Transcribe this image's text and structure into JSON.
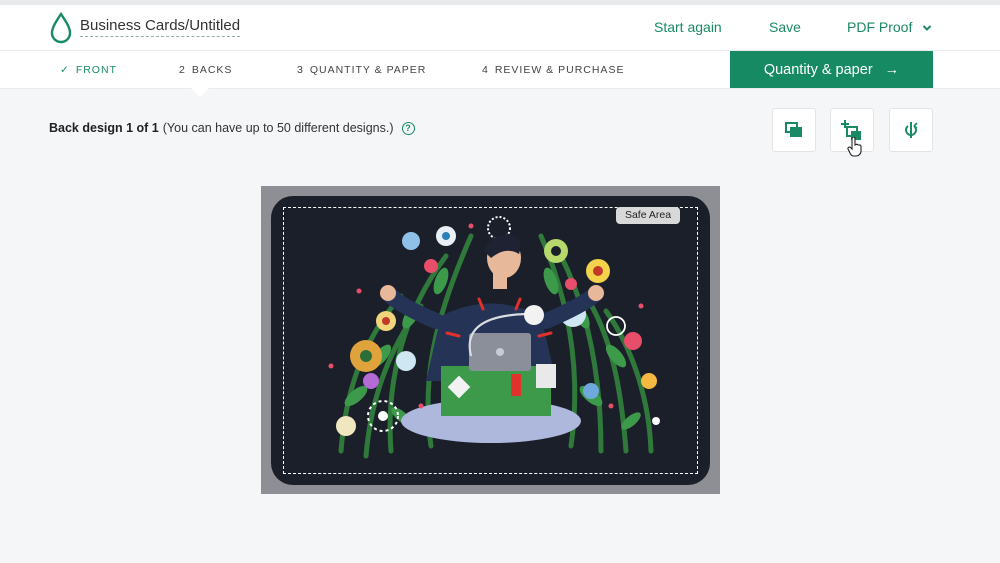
{
  "header": {
    "doc_title": "Business Cards/Untitled",
    "start_again": "Start again",
    "save": "Save",
    "pdf_proof": "PDF Proof"
  },
  "steps": [
    {
      "num": "✓",
      "label": "FRONT",
      "state": "done"
    },
    {
      "num": "2",
      "label": "BACKS",
      "state": "active"
    },
    {
      "num": "3",
      "label": "QUANTITY & PAPER",
      "state": "todo"
    },
    {
      "num": "4",
      "label": "REVIEW & PURCHASE",
      "state": "todo"
    }
  ],
  "cta": {
    "label": "Quantity & paper",
    "arrow": "→"
  },
  "design_info": {
    "bold": "Back design 1 of 1",
    "note": "(You can have up to 50 different designs.)",
    "help": "?"
  },
  "canvas": {
    "safe_area_label": "Safe Area"
  },
  "colors": {
    "accent": "#168a63",
    "card_bg": "#1b1f2a",
    "canvas_bg": "#8d8f94"
  },
  "icons": [
    "drop-logo-icon",
    "chevron-down-icon",
    "arrow-right-icon",
    "help-icon",
    "duplicate-design-icon",
    "add-design-icon",
    "flip-icon",
    "hand-cursor-icon"
  ]
}
